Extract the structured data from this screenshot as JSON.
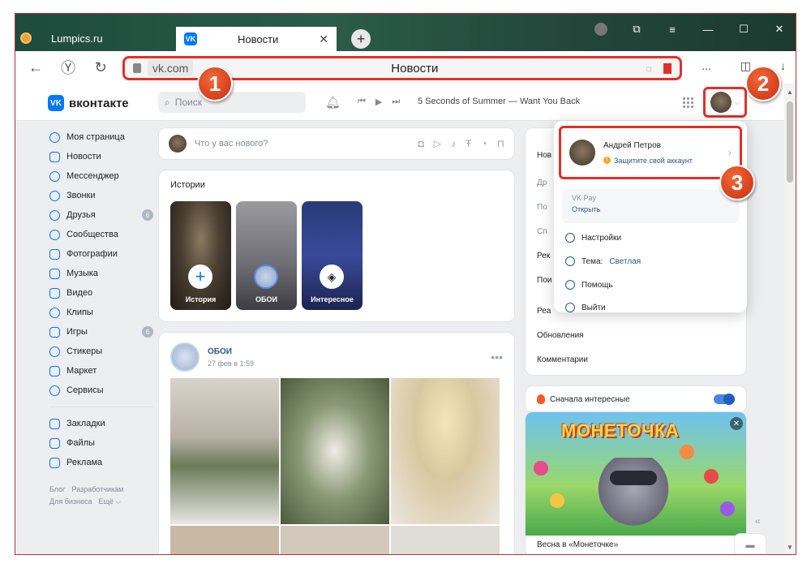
{
  "browser": {
    "inactive_tab": "Lumpics.ru",
    "active_tab": "Новости",
    "tab_close": "✕",
    "new_tab": "+",
    "address_domain": "vk.com",
    "address_title": "Новости",
    "more": "...",
    "colors": {
      "highlight": "#e0302a"
    }
  },
  "annotations": [
    "1",
    "2",
    "3"
  ],
  "header": {
    "logo": "вконтакте",
    "search_placeholder": "Поиск",
    "track": "5 Seconds of Summer — Want You Back"
  },
  "nav": {
    "items": [
      {
        "label": "Моя страница"
      },
      {
        "label": "Новости"
      },
      {
        "label": "Мессенджер"
      },
      {
        "label": "Звонки"
      },
      {
        "label": "Друзья",
        "count": "6"
      },
      {
        "label": "Сообщества"
      },
      {
        "label": "Фотографии"
      },
      {
        "label": "Музыка"
      },
      {
        "label": "Видео"
      },
      {
        "label": "Клипы"
      },
      {
        "label": "Игры",
        "count": "6"
      },
      {
        "label": "Стикеры"
      },
      {
        "label": "Маркет"
      },
      {
        "label": "Сервисы"
      }
    ],
    "extra": [
      {
        "label": "Закладки"
      },
      {
        "label": "Файлы"
      },
      {
        "label": "Реклама"
      }
    ],
    "footer": {
      "blog": "Блог",
      "dev": "Разработчикам",
      "business": "Для бизнеса",
      "more": "Ещё ⌵"
    }
  },
  "composer": {
    "placeholder": "Что у вас нового?"
  },
  "stories": {
    "title": "Истории",
    "items": [
      {
        "label": "История"
      },
      {
        "label": "ОБОИ"
      },
      {
        "label": "Интересное"
      }
    ]
  },
  "post": {
    "author": "ОБОИ",
    "date": "27 фев в 1:59",
    "menu": "•••"
  },
  "right_menu": {
    "items": [
      "Нов",
      "Др",
      "По",
      "Сп",
      "Рек",
      "Пои",
      "Реа",
      "Обновления",
      "Комментарии"
    ]
  },
  "feed_toggle": {
    "label": "Сначала интересные",
    "on": true
  },
  "promo": {
    "logo_text": "МОНЕТОЧКА",
    "caption": "Весна в «Монеточке»"
  },
  "dropdown": {
    "name": "Андрей Петров",
    "warning": "Защитите свой аккаунт",
    "pay_title": "VK Pay",
    "pay_link": "Открыть",
    "settings": "Настройки",
    "theme_label": "Тема:",
    "theme_value": "Светлая",
    "help": "Помощь",
    "logout": "Выйти"
  }
}
